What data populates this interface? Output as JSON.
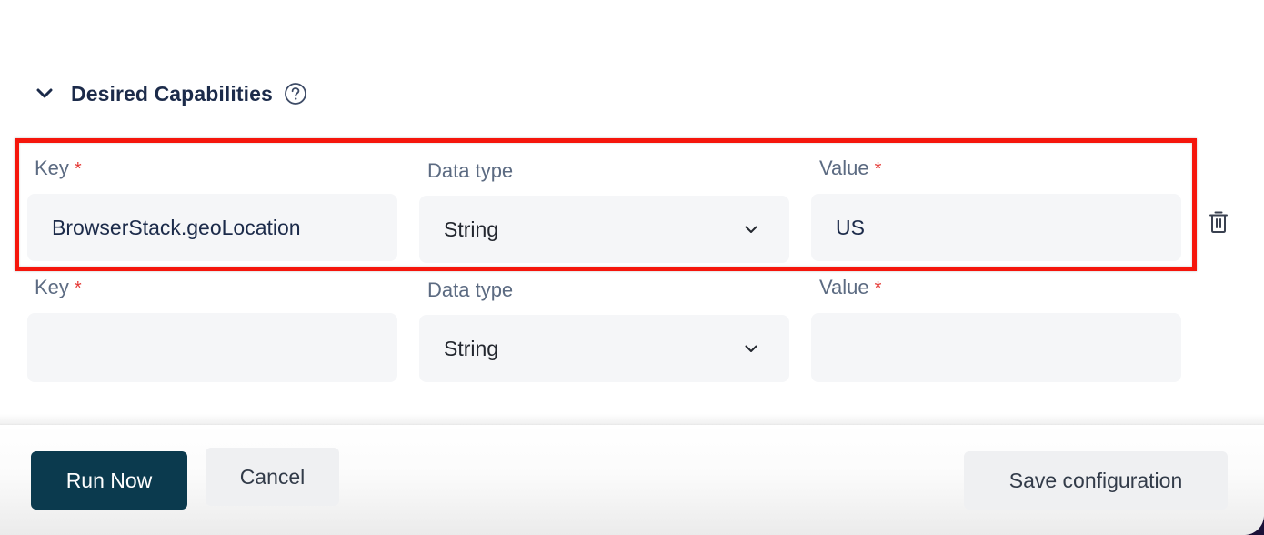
{
  "section": {
    "title": "Desired Capabilities",
    "toggle_icon": "chevron-down-icon",
    "help_icon": "question-circle-icon",
    "expanded": true
  },
  "capabilities": {
    "rows": [
      {
        "key_label": "Key",
        "key_required_mark": "*",
        "key_value": "BrowserStack.geoLocation",
        "datatype_label": "Data type",
        "datatype_value": "String",
        "value_label": "Value",
        "value_required_mark": "*",
        "value_value": "US",
        "delete_icon": "trash-icon",
        "highlighted": true
      },
      {
        "key_label": "Key",
        "key_required_mark": "*",
        "key_value": "",
        "datatype_label": "Data type",
        "datatype_value": "String",
        "value_label": "Value",
        "value_required_mark": "*",
        "value_value": "",
        "highlighted": false
      }
    ]
  },
  "footer": {
    "run_now_label": "Run Now",
    "cancel_label": "Cancel",
    "save_label": "Save configuration"
  },
  "colors": {
    "primary_button": "#0b3a4e",
    "highlight_border": "#f5160c",
    "required_mark": "#e53935",
    "title_text": "#1c2b4a",
    "label_text": "#5c6b82",
    "field_background": "#f5f6f8"
  }
}
